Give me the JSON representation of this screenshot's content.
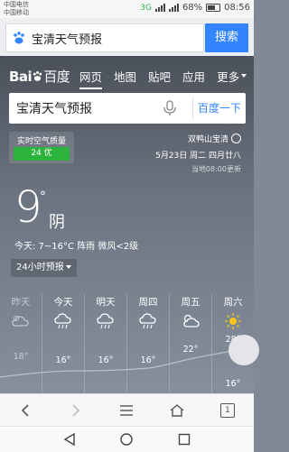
{
  "status": {
    "carrier_line1": "中国电信",
    "carrier_line2": "中国移动",
    "network": "3G",
    "battery": "68%",
    "time": "08:56"
  },
  "browser": {
    "query": "宝清天气预报",
    "search_button": "搜索"
  },
  "baidu_nav": {
    "logo_prefix": "Bai",
    "logo_suffix": "百度",
    "items": [
      "网页",
      "地图",
      "贴吧",
      "应用",
      "更多"
    ]
  },
  "main_search": {
    "query": "宝清天气预报",
    "button": "百度一下"
  },
  "aqi": {
    "label": "实时空气质量",
    "value": "24 优",
    "color": "#2bb33c"
  },
  "location": {
    "name": "双鸭山宝清",
    "date": "5月23日 周二 四月廿八",
    "updated": "当地08:00更新"
  },
  "current": {
    "temp": "9",
    "deg": "°",
    "condition": "阴",
    "detail": "今天: 7~16°C 阵雨 微风<2级",
    "hourly_button": "24小时预报"
  },
  "forecast": [
    {
      "day": "昨天",
      "icon": "cloudy-icon",
      "high": "18°"
    },
    {
      "day": "今天",
      "icon": "rain-icon",
      "high": "16°"
    },
    {
      "day": "明天",
      "icon": "rain-icon",
      "high": "16°"
    },
    {
      "day": "周四",
      "icon": "rain-icon",
      "high": "16°"
    },
    {
      "day": "周五",
      "icon": "partly-cloudy-icon",
      "high": "22°"
    },
    {
      "day": "周六",
      "icon": "sunny-icon",
      "high": "28°"
    }
  ],
  "extra_low": "16°",
  "colors": {
    "accent": "#3385ff",
    "card_top": "#4a5059",
    "card_bottom": "#86909c"
  },
  "toolbar": {
    "tab_count": "1"
  }
}
